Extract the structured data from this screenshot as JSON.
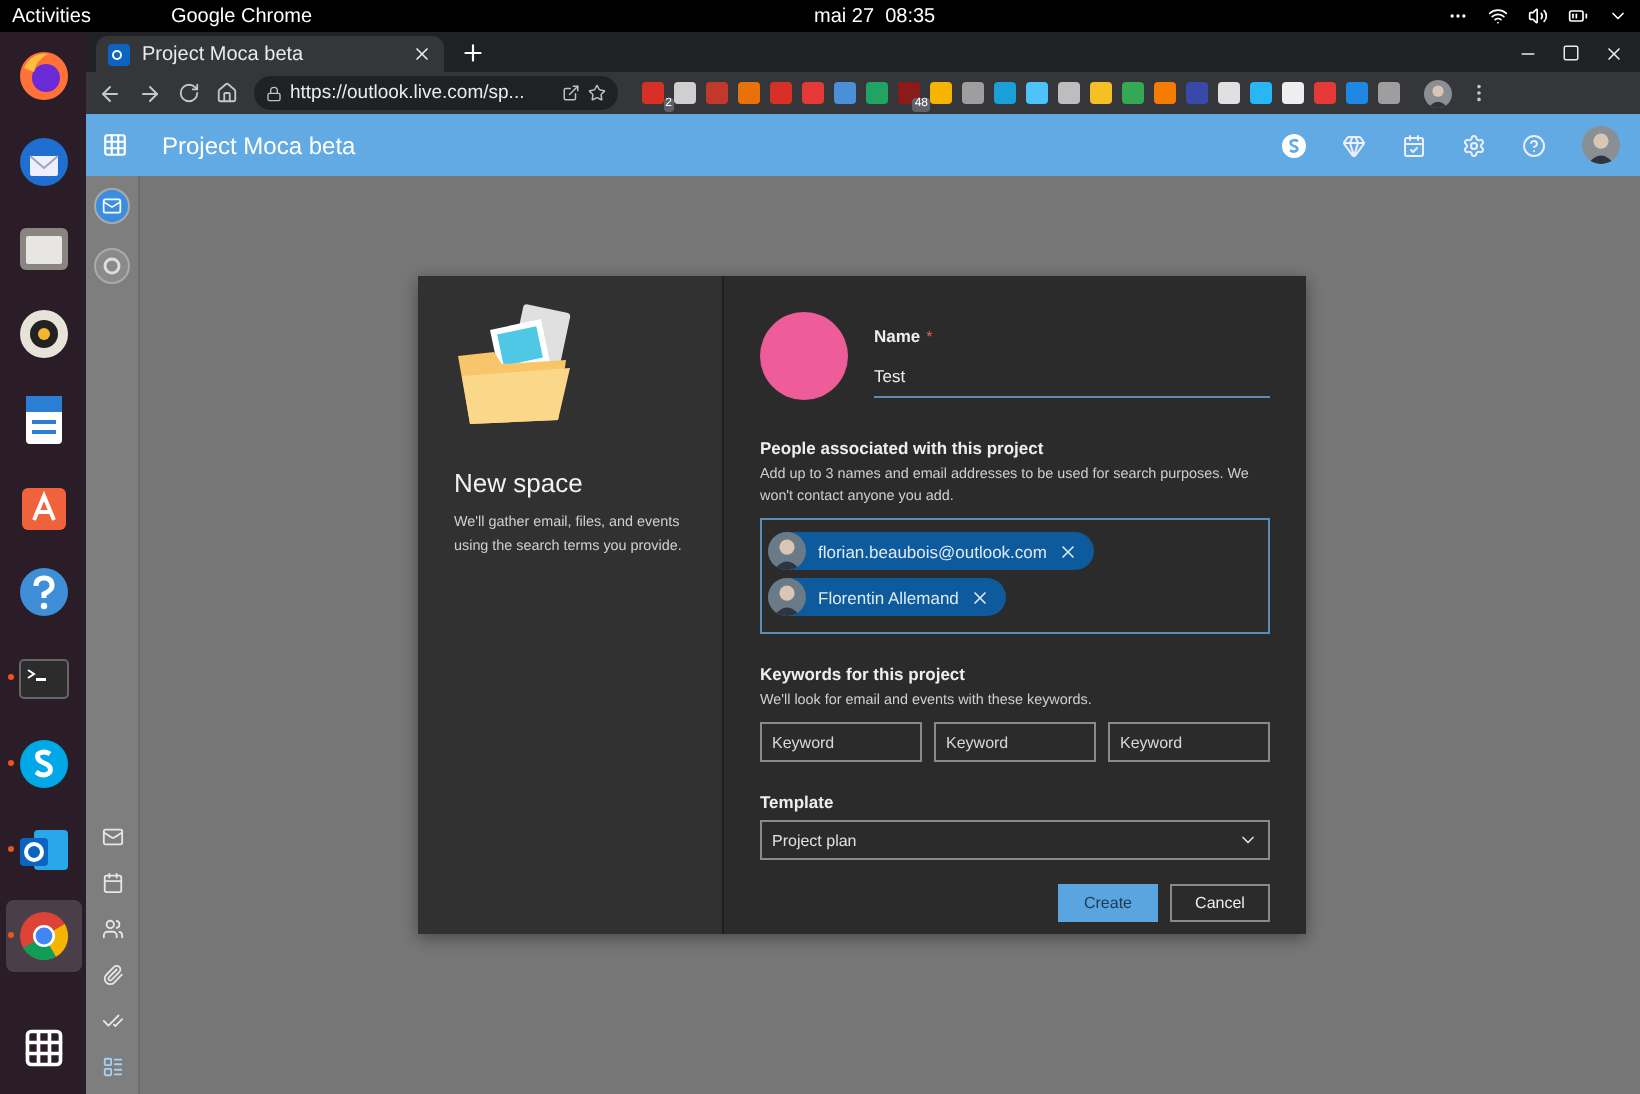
{
  "system_bar": {
    "activities": "Activities",
    "app": "Google Chrome",
    "clock": "mai 27  08:35"
  },
  "dock": [
    {
      "kind": "firefox",
      "running": false,
      "selected": false
    },
    {
      "kind": "thunderbird",
      "running": false,
      "selected": false
    },
    {
      "kind": "files",
      "running": false,
      "selected": false
    },
    {
      "kind": "rhythmbox",
      "running": false,
      "selected": false
    },
    {
      "kind": "writer",
      "running": false,
      "selected": false
    },
    {
      "kind": "software",
      "running": false,
      "selected": false
    },
    {
      "kind": "help",
      "running": false,
      "selected": false
    },
    {
      "kind": "terminal",
      "running": true,
      "selected": false
    },
    {
      "kind": "skype",
      "running": true,
      "selected": false
    },
    {
      "kind": "outlook",
      "running": true,
      "selected": false
    },
    {
      "kind": "chrome",
      "running": true,
      "selected": true
    }
  ],
  "browser": {
    "tab_title": "Project Moca beta",
    "url": "https://outlook.live.com/sp...",
    "extensions": [
      {
        "color": "#d93025",
        "badge": "2"
      },
      {
        "color": "#cfcfcf"
      },
      {
        "color": "#c0392b"
      },
      {
        "color": "#e8710a"
      },
      {
        "color": "#d93025"
      },
      {
        "color": "#e53935"
      },
      {
        "color": "#4a90d9"
      },
      {
        "color": "#1fa463"
      },
      {
        "color": "#8b1a1a",
        "badge": "48"
      },
      {
        "color": "#f4b400"
      },
      {
        "color": "#9e9e9e"
      },
      {
        "color": "#1a9fd8"
      },
      {
        "color": "#4fc3f7"
      },
      {
        "color": "#bdbdbd"
      },
      {
        "color": "#f6bf26"
      },
      {
        "color": "#34a853"
      },
      {
        "color": "#f57c00"
      },
      {
        "color": "#3949ab"
      },
      {
        "color": "#e0e0e0"
      },
      {
        "color": "#29b6f6"
      },
      {
        "color": "#eeeeee"
      },
      {
        "color": "#e53935"
      },
      {
        "color": "#1e88e5"
      },
      {
        "color": "#9e9e9e"
      }
    ]
  },
  "app": {
    "title": "Project Moca beta"
  },
  "dialog": {
    "title": "New space",
    "description": "We'll gather email, files, and events using the search terms you provide.",
    "name_label": "Name",
    "required_mark": "*",
    "name_value": "Test",
    "people_heading": "People associated with this project",
    "people_description": "Add up to 3 names and email addresses to be used for search purposes. We won't contact anyone you add.",
    "people": [
      {
        "name": "florian.beaubois@outlook.com"
      },
      {
        "name": "Florentin Allemand"
      }
    ],
    "keywords_heading": "Keywords for this project",
    "keywords_description": "We'll look for email and events with these keywords.",
    "keywords": [
      {
        "placeholder": "Keyword"
      },
      {
        "placeholder": "Keyword"
      },
      {
        "placeholder": "Keyword"
      }
    ],
    "template_label": "Template",
    "template_value": "Project plan",
    "buttons": [
      {
        "kind": "primary",
        "label": "Create"
      },
      {
        "kind": "secondary",
        "label": "Cancel"
      }
    ]
  }
}
